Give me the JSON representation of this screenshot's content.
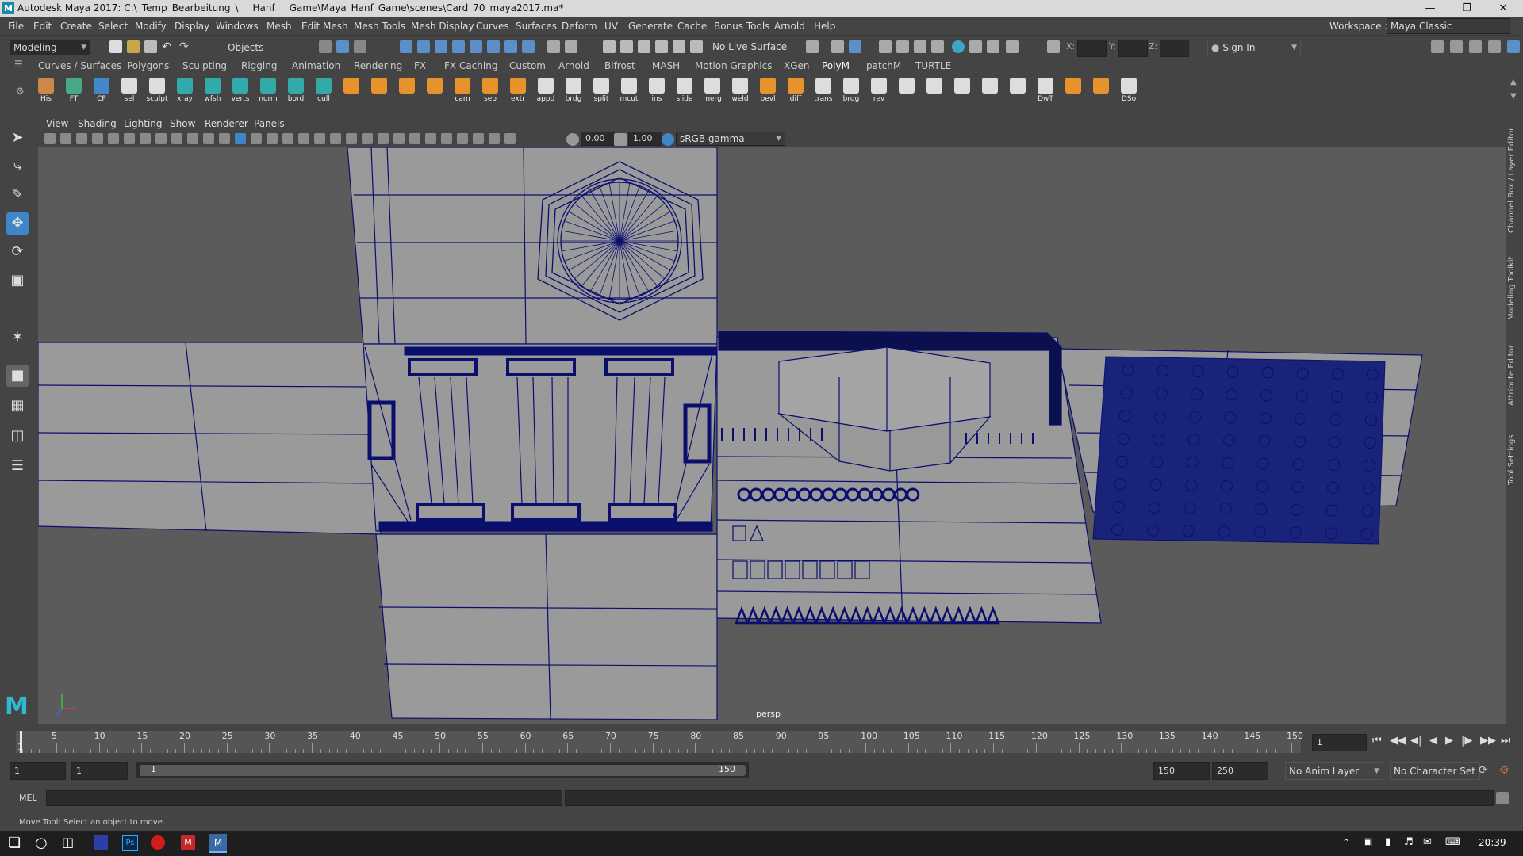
{
  "window": {
    "title": "Autodesk Maya 2017: C:\\_Temp_Bearbeitung_\\___Hanf___Game\\Maya_Hanf_Game\\scenes\\Card_70_maya2017.ma*",
    "logo": "M",
    "workspace_label": "Workspace :",
    "workspace_value": "Maya Classic"
  },
  "menu": [
    "File",
    "Edit",
    "Create",
    "Select",
    "Modify",
    "Display",
    "Windows",
    "Mesh",
    "Edit Mesh",
    "Mesh Tools",
    "Mesh Display",
    "Curves",
    "Surfaces",
    "Deform",
    "UV",
    "Generate",
    "Cache",
    "Bonus Tools",
    "Arnold",
    "Help"
  ],
  "status": {
    "mode": "Modeling",
    "selection_mode": "Objects",
    "live_surface": "No Live Surface",
    "x_label": "X:",
    "y_label": "Y:",
    "z_label": "Z:",
    "sign_in": "Sign In"
  },
  "shelf_tabs": [
    "Curves / Surfaces",
    "Polygons",
    "Sculpting",
    "Rigging",
    "Animation",
    "Rendering",
    "FX",
    "FX Caching",
    "Custom",
    "Arnold",
    "Bifrost",
    "MASH",
    "Motion Graphics",
    "XGen",
    "PolyM",
    "patchM",
    "TURTLE"
  ],
  "shelf_active": "PolyM",
  "shelf_buttons": [
    "His",
    "FT",
    "CP",
    "sel",
    "sculpt",
    "xray",
    "wfsh",
    "verts",
    "norm",
    "bord",
    "cull",
    "",
    "",
    "",
    "",
    "cam",
    "sep",
    "extr",
    "appd",
    "brdg",
    "split",
    "mcut",
    "ins",
    "slide",
    "merg",
    "weld",
    "bevl",
    "diff",
    "trans",
    "brdg",
    "rev",
    "",
    "",
    "",
    "",
    "",
    "DwT",
    "",
    "",
    "DSo"
  ],
  "viewport": {
    "menu": [
      "View",
      "Shading",
      "Lighting",
      "Show",
      "Renderer",
      "Panels"
    ],
    "exposure": "0.00",
    "gamma": "1.00",
    "color_space": "sRGB gamma",
    "camera": "persp"
  },
  "right_tabs": [
    "Channel Box / Layer Editor",
    "Modeling Toolkit",
    "Attribute Editor",
    "Tool Settings"
  ],
  "timeline": {
    "ticks": [
      "5",
      "10",
      "15",
      "20",
      "25",
      "30",
      "35",
      "40",
      "45",
      "50",
      "55",
      "60",
      "65",
      "70",
      "75",
      "80",
      "85",
      "90",
      "95",
      "100",
      "105",
      "110",
      "115",
      "120",
      "125",
      "130",
      "135",
      "140",
      "145",
      "150"
    ],
    "first": "1",
    "current_frame": "1"
  },
  "range": {
    "start": "1",
    "anim_start": "1",
    "slider_start": "1",
    "slider_end": "150",
    "end": "150",
    "anim_end": "250",
    "anim_layer": "No Anim Layer",
    "character_set": "No Character Set"
  },
  "command": {
    "lang": "MEL"
  },
  "help_line": "Move Tool: Select an object to move.",
  "taskbar": {
    "time": "20:39"
  },
  "colors": {
    "wire": "#0a0f6e",
    "surface": "#9a9a9a",
    "viewport_bg": "#5b5b5b",
    "accent": "#3f86c6"
  }
}
